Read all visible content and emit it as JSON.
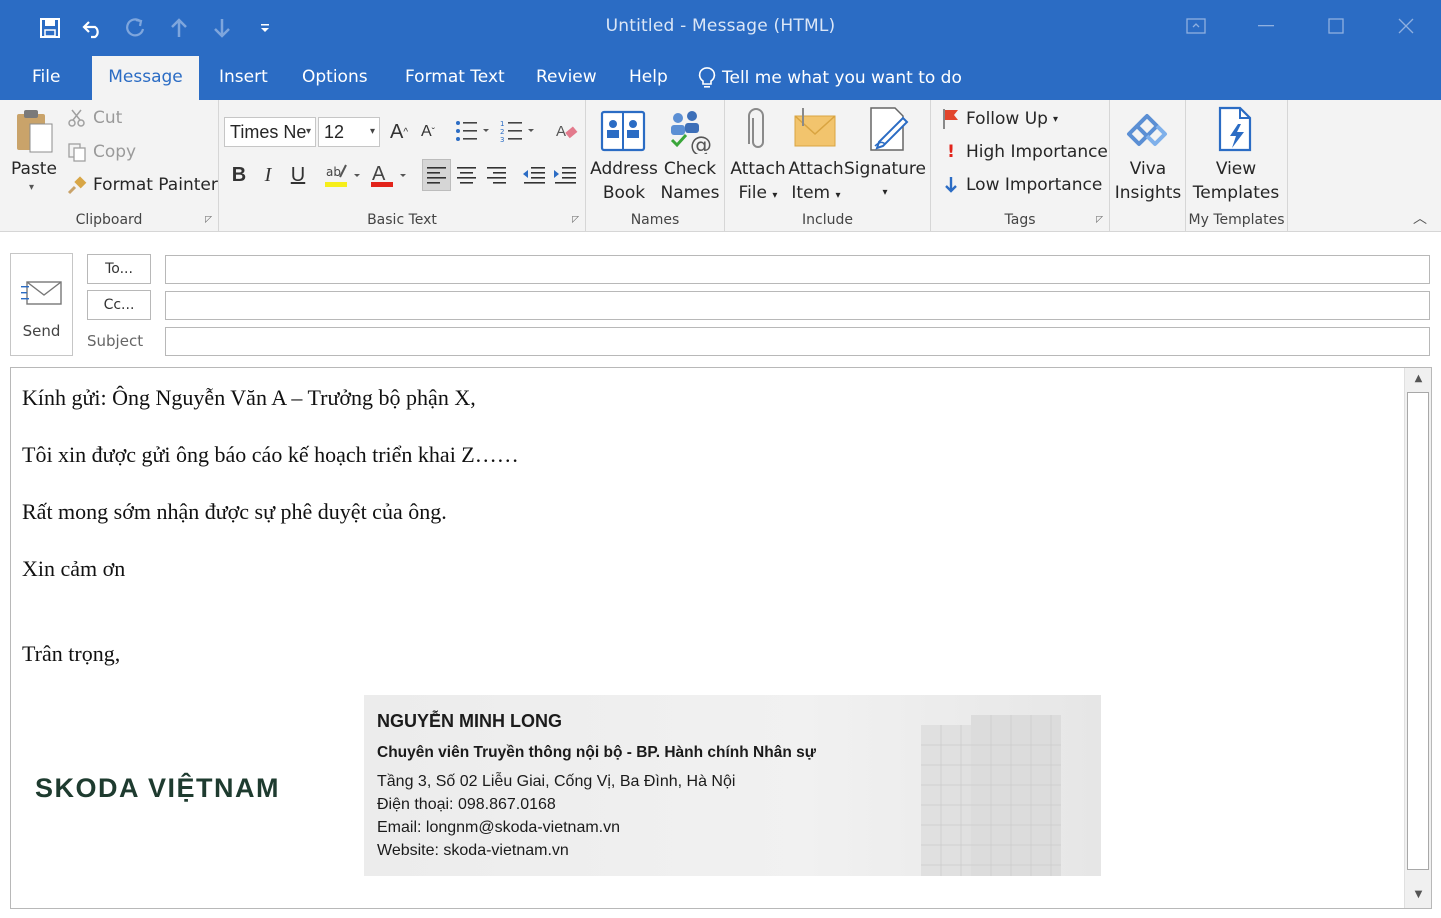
{
  "window": {
    "title": "Untitled  -  Message (HTML)",
    "title_bar_color": "#2b6cc4"
  },
  "quick_access": [
    "save-icon",
    "undo-icon",
    "redo-icon",
    "up-arrow-icon",
    "down-arrow-icon",
    "customize-icon"
  ],
  "tabs": [
    {
      "label": "File"
    },
    {
      "label": "Message"
    },
    {
      "label": "Insert"
    },
    {
      "label": "Options"
    },
    {
      "label": "Format Text"
    },
    {
      "label": "Review"
    },
    {
      "label": "Help"
    }
  ],
  "tell_me": "Tell me what you want to do",
  "ribbon": {
    "clipboard": {
      "label": "Clipboard",
      "paste": "Paste",
      "cut": "Cut",
      "copy": "Copy",
      "format_painter": "Format Painter"
    },
    "basic_text": {
      "label": "Basic Text",
      "font": "Times Ne",
      "size": "12",
      "bold": "B",
      "italic": "I",
      "underline": "U",
      "grow": "A",
      "shrink": "A"
    },
    "names": {
      "label": "Names",
      "address_book": [
        "Address",
        "Book"
      ],
      "check_names": [
        "Check",
        "Names"
      ]
    },
    "include": {
      "label": "Include",
      "attach_file": [
        "Attach",
        "File"
      ],
      "attach_item": [
        "Attach",
        "Item"
      ],
      "signature": "Signature"
    },
    "tags": {
      "label": "Tags",
      "follow_up": "Follow Up",
      "high_importance": "High Importance",
      "low_importance": "Low Importance"
    },
    "viva": {
      "label_lines": [
        "Viva",
        "Insights"
      ]
    },
    "my_templates": {
      "label": "My Templates",
      "view_templates": [
        "View",
        "Templates"
      ]
    }
  },
  "header": {
    "send": "Send",
    "to": "To...",
    "cc": "Cc...",
    "subject": "Subject",
    "to_value": "",
    "cc_value": "",
    "subject_value": ""
  },
  "body": {
    "paragraphs": [
      "Kính gửi: Ông Nguyễn Văn A – Trưởng bộ phận X,",
      "Tôi xin được gửi ông báo cáo kế hoạch triển khai Z……",
      "Rất mong sớm nhận được sự phê duyệt của ông.",
      "Xin cảm ơn",
      "Trân trọng,"
    ]
  },
  "signature": {
    "logo": "SKODA VIỆTNAM",
    "name": "NGUYỄN MINH LONG",
    "title": "Chuyên viên Truyền thông nội bộ - BP. Hành chính Nhân sự",
    "address": "Tầng 3, Số 02 Liễu Giai, Cống Vị, Ba Đình, Hà Nội",
    "phone": "Điện thoại: 098.867.0168",
    "email": "Email: longnm@skoda-vietnam.vn",
    "website": "Website: skoda-vietnam.vn"
  }
}
